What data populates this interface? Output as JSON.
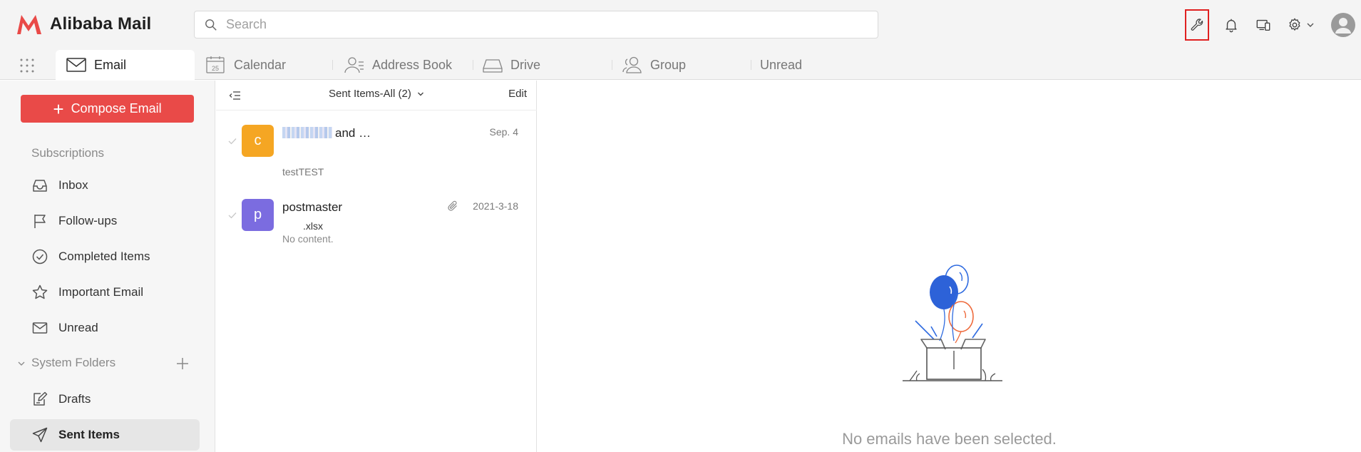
{
  "brand": {
    "name": "Alibaba Mail",
    "accent": "#e94a48"
  },
  "search": {
    "placeholder": "Search"
  },
  "top_icons": [
    "wrench-icon",
    "bell-icon",
    "devices-icon",
    "gear-icon",
    "user-avatar-icon"
  ],
  "tabs": [
    {
      "label": "Email",
      "icon": "envelope-icon",
      "active": true
    },
    {
      "label": "Calendar",
      "icon": "calendar-icon",
      "calendar_day": "25"
    },
    {
      "label": "Address Book",
      "icon": "contacts-icon"
    },
    {
      "label": "Drive",
      "icon": "drive-icon"
    },
    {
      "label": "Group",
      "icon": "group-icon"
    },
    {
      "label": "Unread",
      "icon": ""
    }
  ],
  "sidebar": {
    "compose_label": "Compose Email",
    "subscriptions_label": "Subscriptions",
    "subscription_items": [
      {
        "label": "Inbox",
        "icon": "inbox-icon"
      },
      {
        "label": "Follow-ups",
        "icon": "flag-icon"
      },
      {
        "label": "Completed Items",
        "icon": "check-circle-icon"
      },
      {
        "label": "Important Email",
        "icon": "star-icon"
      },
      {
        "label": "Unread",
        "icon": "envelope-icon"
      }
    ],
    "system_folders_label": "System Folders",
    "system_items": [
      {
        "label": "Drafts",
        "icon": "drafts-icon"
      },
      {
        "label": "Sent Items",
        "icon": "send-icon",
        "selected": true
      }
    ]
  },
  "list": {
    "folder_title": "Sent Items-All (2)",
    "edit_label": "Edit",
    "messages": [
      {
        "avatar_letter": "c",
        "avatar_color": "#f5a623",
        "sender_suffix": "and …",
        "date": "Sep. 4",
        "preview": "testTEST",
        "attachment": false
      },
      {
        "avatar_letter": "p",
        "avatar_color": "#7b6ce0",
        "sender": "postmaster",
        "date": "2021-3-18",
        "subject": ".xlsx",
        "preview": "No content.",
        "attachment": true
      }
    ]
  },
  "reading": {
    "empty_text": "No emails have been selected."
  }
}
